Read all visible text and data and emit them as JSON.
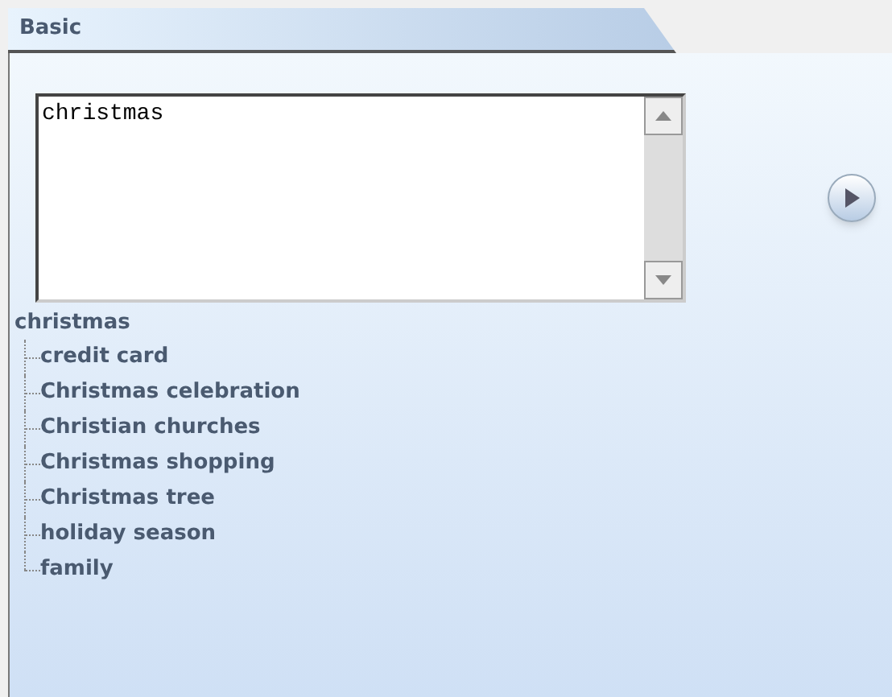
{
  "tabs": [
    {
      "label": "Basic",
      "selected": true
    }
  ],
  "query": {
    "value": "christmas"
  },
  "tree": {
    "label": "christmas",
    "children": [
      {
        "label": "credit card"
      },
      {
        "label": "Christmas celebration"
      },
      {
        "label": "Christian churches"
      },
      {
        "label": "Christmas shopping"
      },
      {
        "label": "Christmas tree"
      },
      {
        "label": "holiday season"
      },
      {
        "label": "family"
      }
    ]
  }
}
